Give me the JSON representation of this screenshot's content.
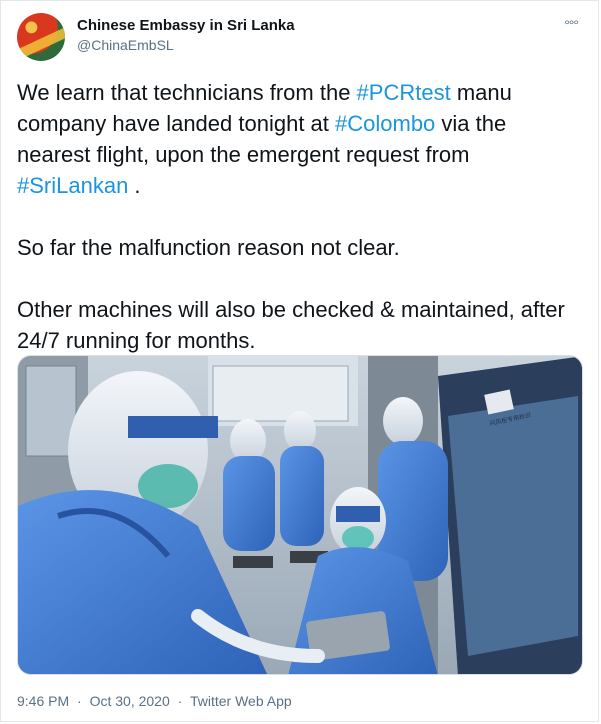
{
  "account": {
    "display_name": "Chinese Embassy in Sri Lanka",
    "handle": "@ChinaEmbSL"
  },
  "menu": {
    "more_icon": "more-horizontal-icon",
    "more_glyph": "°°°"
  },
  "tweet": {
    "p1_a": "We learn that technicians from the ",
    "hashtag_pcr": "#PCRtest",
    "p1_b": " manu company have landed tonight at ",
    "hashtag_colombo": "#Colombo",
    "p1_c": " via the nearest flight, upon the emergent request from ",
    "hashtag_srilankan": "#SriLankan",
    "p1_d": " .",
    "p2": "So far the malfunction reason not clear.",
    "p3": "Other machines will also be checked & maintained, after 24/7 running for months."
  },
  "media": {
    "description_icon": "lab-photo-image",
    "cabinet_label": "问风柜专用标识"
  },
  "footer": {
    "time": "9:46 PM",
    "separator": "·",
    "date": "Oct 30, 2020",
    "source": "Twitter Web App"
  },
  "colors": {
    "text": "#0f1419",
    "muted": "#5b7083",
    "hashtag": "#1b95e0",
    "ppe_blue": "#3f7fd6"
  }
}
